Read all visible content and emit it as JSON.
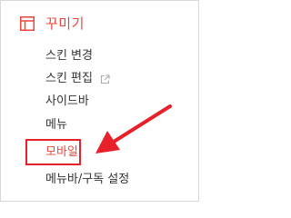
{
  "section": {
    "title": "꾸미기",
    "icon": "layout-icon",
    "accent_color": "#e8483c"
  },
  "menu": {
    "items": [
      {
        "label": "스킨 변경"
      },
      {
        "label": "스킨 편집",
        "trailing_icon": "external-link-icon"
      },
      {
        "label": "사이드바"
      },
      {
        "label": "메뉴"
      },
      {
        "label": "모바일",
        "highlighted": true
      },
      {
        "label": "메뉴바/구독 설정"
      }
    ]
  },
  "annotation": {
    "highlight_color": "#e8202a",
    "arrow_icon": "red-arrow-icon"
  }
}
